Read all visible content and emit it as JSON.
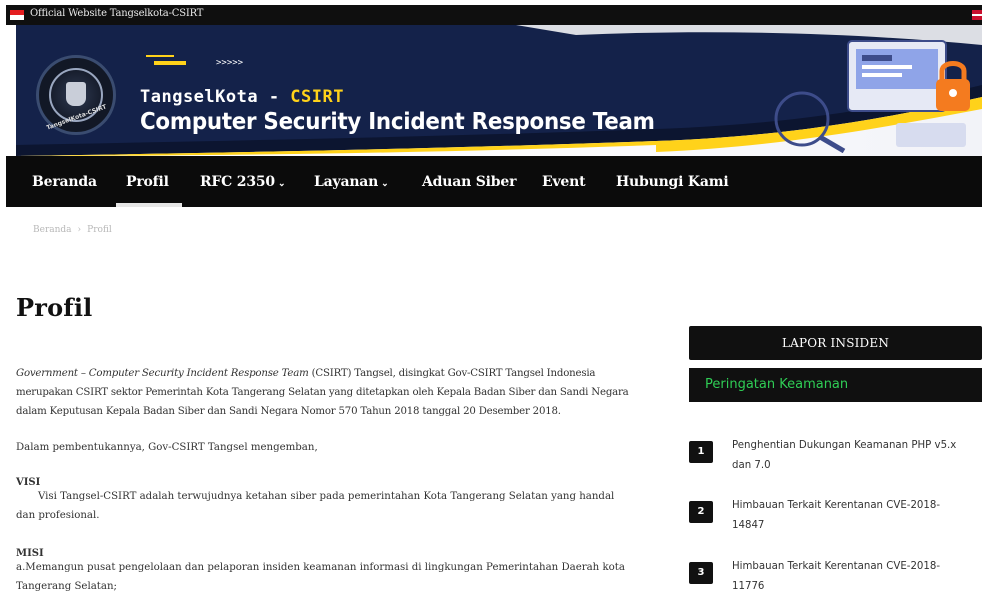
{
  "topbar": {
    "site_label": "Official Website Tangselkota-CSIRT"
  },
  "banner": {
    "brand_name": "TangselKota - ",
    "brand_accent": "CSIRT",
    "brand_subtitle": "Computer Security Incident Response Team",
    "logo_caption": "TangselKota-CSIRT",
    "decor_chevrons": ">>>>>"
  },
  "nav": {
    "items": [
      {
        "label": "Beranda",
        "has_caret": false
      },
      {
        "label": "Profil",
        "has_caret": false,
        "active": true
      },
      {
        "label": "RFC 2350",
        "has_caret": true
      },
      {
        "label": "Layanan",
        "has_caret": true
      },
      {
        "label": "Aduan Siber",
        "has_caret": false
      },
      {
        "label": "Event",
        "has_caret": false
      },
      {
        "label": "Hubungi Kami",
        "has_caret": false
      }
    ],
    "caret": "⌄"
  },
  "breadcrumb": {
    "home": "Beranda",
    "separator": "›",
    "current": "Profil"
  },
  "page": {
    "title": "Profil",
    "intro_italic": "Government – Computer Security Incident Response Team",
    "intro_rest": " (CSIRT) Tangsel, disingkat Gov-CSIRT Tangsel Indonesia merupakan CSIRT sektor Pemerintah Kota Tangerang Selatan yang ditetapkan oleh Kepala Badan Siber dan Sandi Negara dalam Keputusan Kepala Badan Siber dan Sandi Negara Nomor 570 Tahun 2018 tanggal 20 Desember 2018.",
    "paragraph2": "Dalam pembentukannya, Gov-CSIRT Tangsel mengemban,",
    "visi_heading": "VISI",
    "visi_text": "Visi Tangsel-CSIRT adalah terwujudnya ketahan siber pada pemerintahan Kota Tangerang Selatan yang handal dan profesional.",
    "misi_heading": "MISI",
    "misi_text": "a.Memangun pusat pengelolaan dan pelaporan insiden keamanan informasi di lingkungan Pemerintahan Daerah kota Tangerang Selatan;"
  },
  "sidebar": {
    "lapor_label": "LAPOR INSIDEN",
    "peringatan_label": "Peringatan Keamanan",
    "alerts": [
      {
        "num": "1",
        "text": "Penghentian Dukungan Keamanan PHP v5.x dan 7.0"
      },
      {
        "num": "2",
        "text": "Himbauan Terkait Kerentanan CVE-2018-14847"
      },
      {
        "num": "3",
        "text": "Himbauan Terkait Kerentanan CVE-2018-11776"
      }
    ]
  },
  "colors": {
    "nav_bg": "#0b0b0b",
    "accent_yellow": "#ffd21a",
    "peringatan_green": "#2fcd55",
    "banner_dark": "#0c1530"
  }
}
